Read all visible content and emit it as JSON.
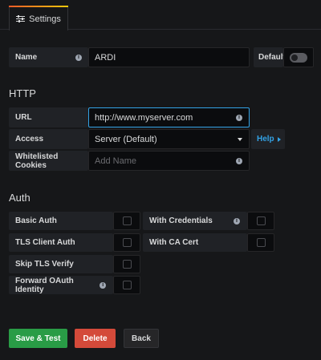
{
  "tab": {
    "label": "Settings",
    "icon": "sliders-icon"
  },
  "name_row": {
    "label": "Name",
    "value": "ARDI",
    "default_label": "Default",
    "default_on": false
  },
  "http": {
    "title": "HTTP",
    "url": {
      "label": "URL",
      "value": "http://www.myserver.com"
    },
    "access": {
      "label": "Access",
      "value": "Server (Default)",
      "help": "Help"
    },
    "cookies": {
      "label": "Whitelisted Cookies",
      "placeholder": "Add Name"
    }
  },
  "auth": {
    "title": "Auth",
    "basic_auth": "Basic Auth",
    "with_credentials": "With Credentials",
    "tls_client_auth": "TLS Client Auth",
    "with_ca_cert": "With CA Cert",
    "skip_tls_verify": "Skip TLS Verify",
    "forward_oauth": "Forward OAuth Identity"
  },
  "buttons": {
    "save": "Save & Test",
    "delete": "Delete",
    "back": "Back"
  },
  "colors": {
    "save": "#299c46",
    "delete": "#d44a3a",
    "back": "#262628",
    "accent": "#33a2e5"
  }
}
